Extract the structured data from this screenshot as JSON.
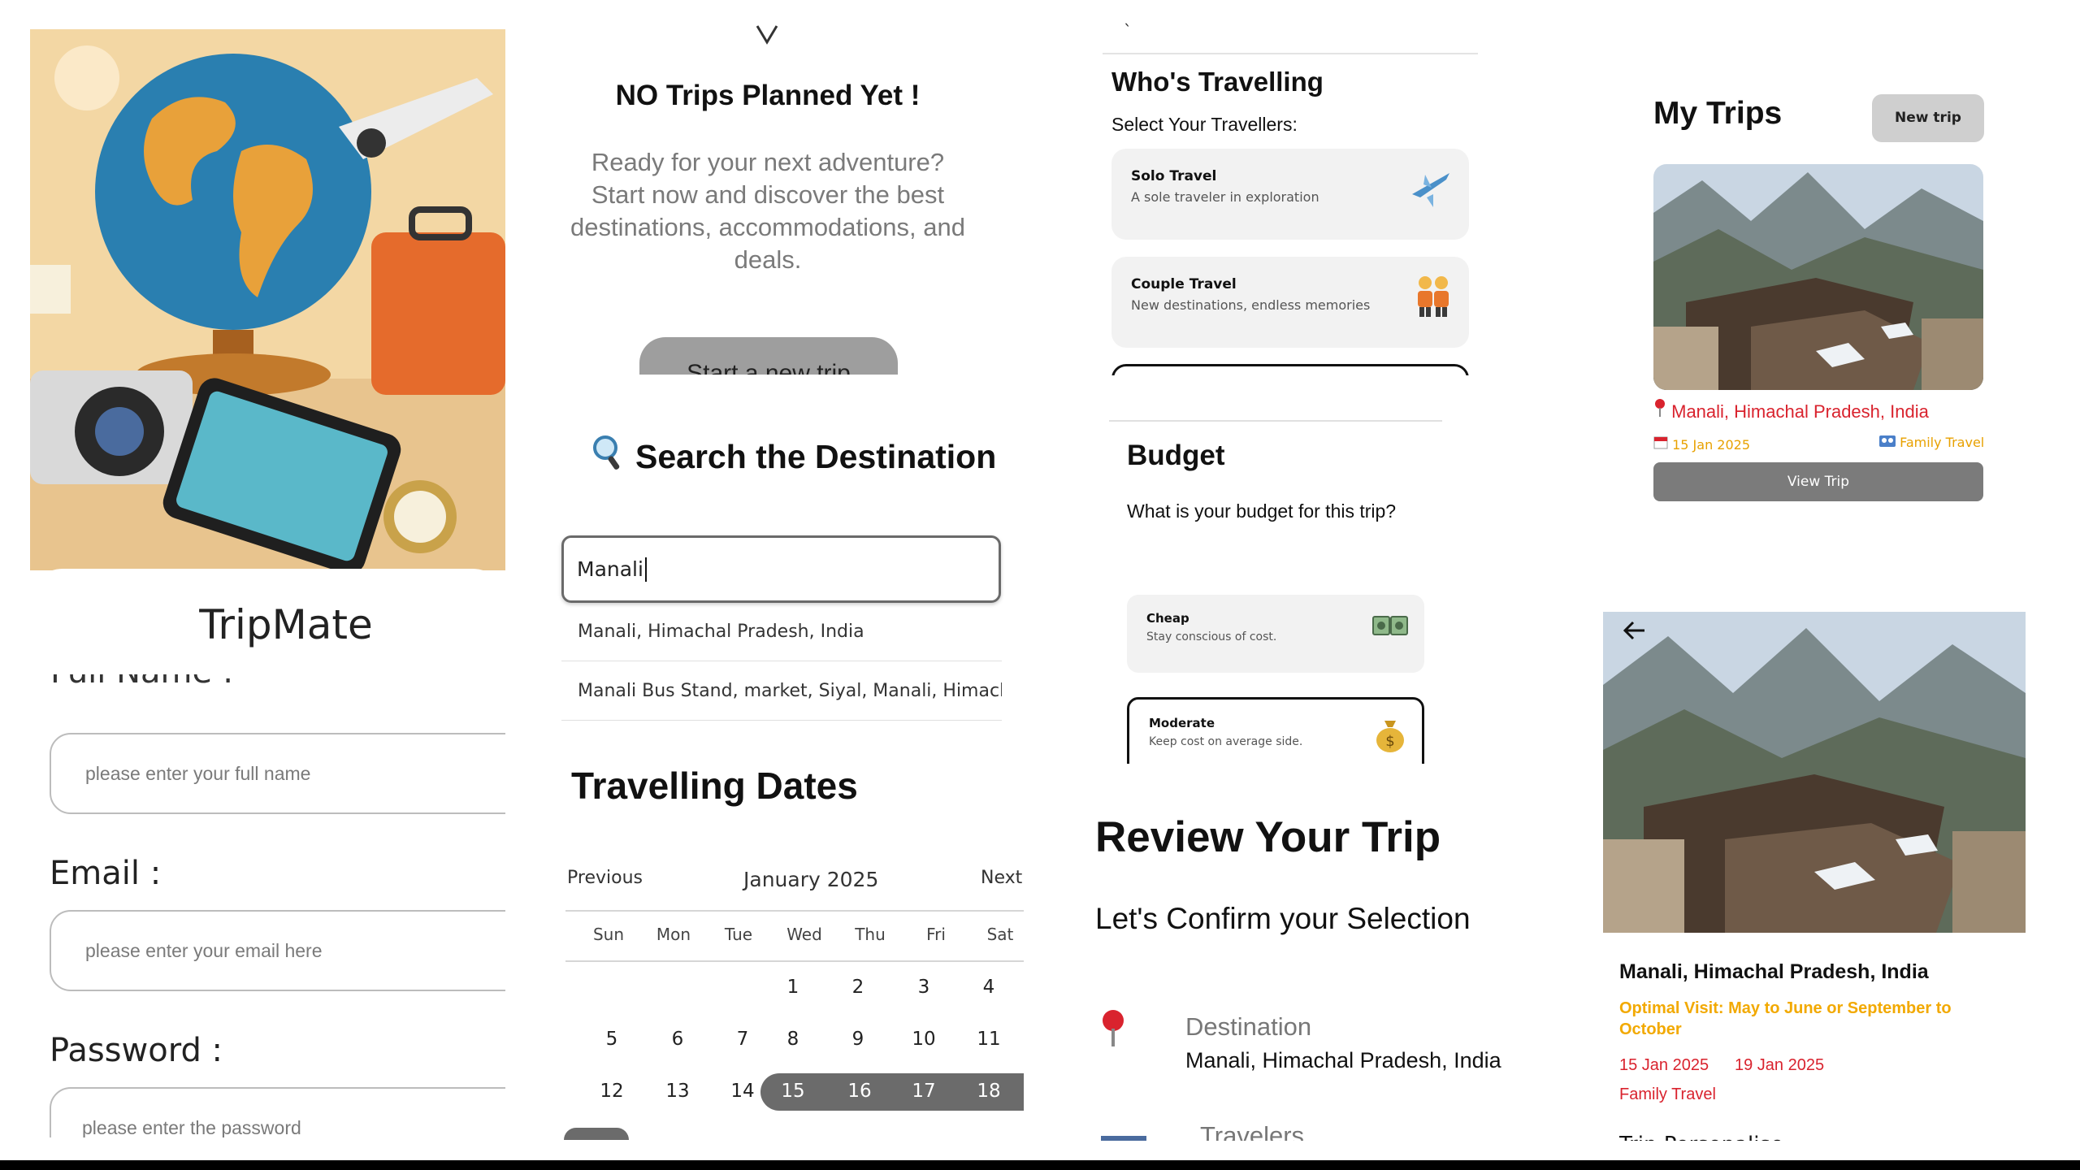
{
  "panel1": {
    "app_title": "TripMate",
    "cut_label": "Full Name :",
    "fullname_placeholder": "please enter your full name",
    "email_label": "Email :",
    "email_placeholder": "please enter your email here",
    "password_label": "Password :",
    "password_placeholder": "please enter the password"
  },
  "no_trips": {
    "title": "NO Trips Planned Yet !",
    "description": "Ready for your next adventure? Start now and discover the best destinations, accommodations, and deals.",
    "start_button": "Start a new trip"
  },
  "search": {
    "title": "Search the Destination",
    "input_value": "Manali",
    "suggestions": [
      "Manali, Himachal Pradesh, India",
      "Manali Bus Stand, market, Siyal, Manali, Himachal Pr"
    ]
  },
  "dates": {
    "title": "Travelling Dates",
    "prev": "Previous",
    "month": "January  2025",
    "next": "Next",
    "weekdays": [
      "Sun",
      "Mon",
      "Tue",
      "Wed",
      "Thu",
      "Fri",
      "Sat"
    ],
    "row1": [
      "1",
      "2",
      "3",
      "4"
    ],
    "row2": [
      "5",
      "6",
      "7",
      "8",
      "9",
      "10",
      "11"
    ],
    "row3": [
      "12",
      "13",
      "14",
      "15",
      "16",
      "17",
      "18"
    ],
    "selected_start": "15",
    "selected_end_visible": "18"
  },
  "travellers": {
    "title": "Who's Travelling",
    "subtitle": "Select Your Travellers:",
    "options": [
      {
        "title": "Solo Travel",
        "desc": "A sole traveler in exploration",
        "icon": "airplane-icon"
      },
      {
        "title": "Couple Travel",
        "desc": "New destinations, endless memories",
        "icon": "couple-icon"
      }
    ]
  },
  "budget": {
    "title": "Budget",
    "question": "What is your budget for this trip?",
    "options": [
      {
        "title": "Cheap",
        "desc": "Stay conscious of cost.",
        "icon": "cash-icon"
      },
      {
        "title": "Moderate",
        "desc": "Keep cost on average side.",
        "icon": "money-bag-icon"
      }
    ]
  },
  "review": {
    "title": "Review Your Trip",
    "subtitle": "Let's Confirm your Selection",
    "destination_label": "Destination",
    "destination_value": "Manali, Himachal Pradesh, India",
    "travelers_label": "Travelers"
  },
  "my_trips": {
    "title": "My Trips",
    "new_trip_button": "New trip",
    "trip": {
      "location": "Manali, Himachal Pradesh, India",
      "date": "15 Jan 2025",
      "type": "Family Travel",
      "view_button": "View Trip"
    }
  },
  "trip_detail": {
    "title": "Manali, Himachal Pradesh, India",
    "optimal_visit": "Optimal Visit: May to June or September to October",
    "start_date": "15 Jan 2025",
    "end_date": "19 Jan 2025",
    "type": "Family Travel",
    "cut_label": "Trip Personalise"
  },
  "colors": {
    "accent_red": "#d9232e",
    "accent_amber": "#f2a900",
    "button_gray": "#7b7b7b",
    "range_gray": "#6b6b6b"
  }
}
